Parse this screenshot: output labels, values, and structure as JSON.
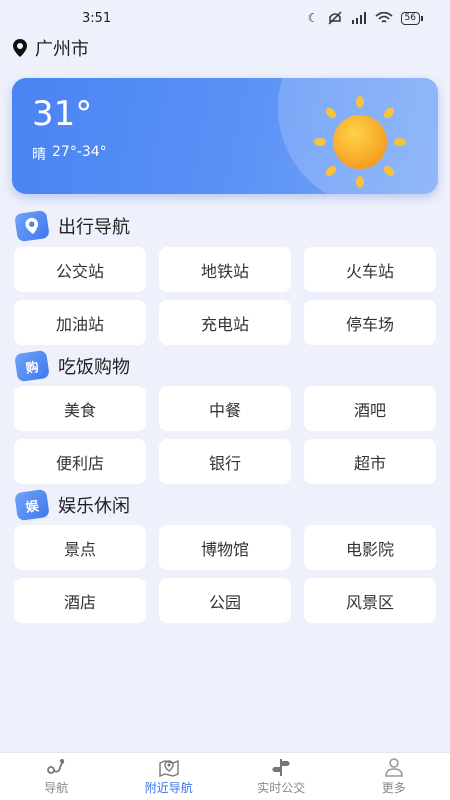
{
  "status_bar": {
    "time": "3:51",
    "battery": "56"
  },
  "location": {
    "city": "广州市"
  },
  "weather": {
    "temperature": "31°",
    "condition": "晴",
    "range": "27°-34°"
  },
  "sections": [
    {
      "title": "出行导航",
      "icon": "map-pin-badge-icon",
      "icon_text": "",
      "items": [
        "公交站",
        "地铁站",
        "火车站",
        "加油站",
        "充电站",
        "停车场"
      ]
    },
    {
      "title": "吃饭购物",
      "icon": "shopping-badge-icon",
      "icon_text": "购",
      "items": [
        "美食",
        "中餐",
        "酒吧",
        "便利店",
        "银行",
        "超市"
      ]
    },
    {
      "title": "娱乐休闲",
      "icon": "entertainment-badge-icon",
      "icon_text": "娱",
      "items": [
        "景点",
        "博物馆",
        "电影院",
        "酒店",
        "公园",
        "风景区"
      ]
    }
  ],
  "tabbar": {
    "active_index": 1,
    "tabs": [
      {
        "label": "导航",
        "icon": "route-icon"
      },
      {
        "label": "附近导航",
        "icon": "map-location-icon"
      },
      {
        "label": "实时公交",
        "icon": "signpost-icon"
      },
      {
        "label": "更多",
        "icon": "user-icon"
      }
    ]
  },
  "colors": {
    "accent": "#3a74ea",
    "card": "#4a83f3",
    "sun": "#f7a928"
  }
}
